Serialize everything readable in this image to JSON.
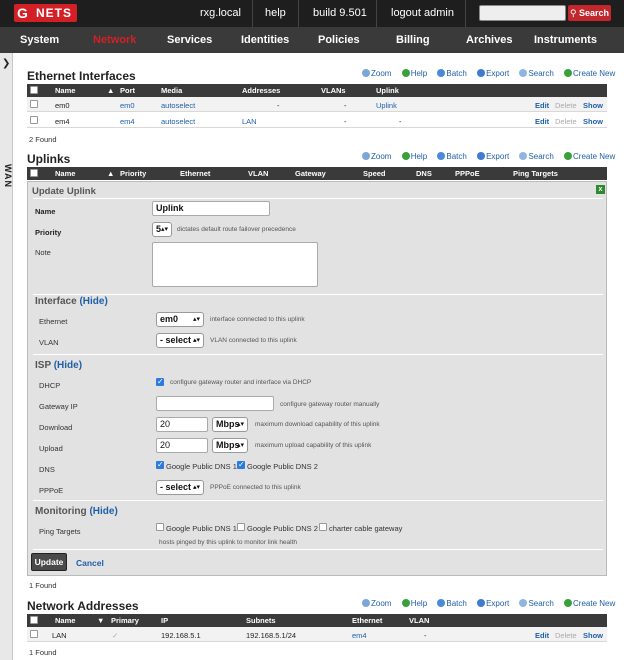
{
  "topbar": {
    "logo_letter": "G",
    "logo_text": "NETS",
    "host": "rxg.local",
    "help": "help",
    "build": "build 9.501",
    "logout": "logout admin",
    "search_placeholder": "",
    "search_button": "Search"
  },
  "nav": [
    "System",
    "Network",
    "Services",
    "Identities",
    "Policies",
    "Billing",
    "Archives",
    "Instruments"
  ],
  "side": {
    "arrow": "❯",
    "label": "WAN"
  },
  "actions": {
    "zoom": "Zoom",
    "help": "Help",
    "batch": "Batch",
    "export": "Export",
    "search": "Search",
    "create": "Create New"
  },
  "ethernet": {
    "title": "Ethernet Interfaces",
    "columns": [
      "Name",
      "Port",
      "Media",
      "Addresses",
      "VLANs",
      "Uplink"
    ],
    "rows": [
      {
        "name": "em0",
        "port": "em0",
        "media": "autoselect",
        "addresses": "-",
        "vlans": "-",
        "uplink": "Uplink"
      },
      {
        "name": "em4",
        "port": "em4",
        "media": "autoselect",
        "addresses": "LAN",
        "vlans": "-",
        "uplink": "-"
      }
    ],
    "found": "2 Found"
  },
  "row_actions": {
    "edit": "Edit",
    "delete": "Delete",
    "show": "Show"
  },
  "uplinks": {
    "title": "Uplinks",
    "columns": [
      "Name",
      "Priority",
      "Ethernet",
      "VLAN",
      "Gateway",
      "Speed",
      "DNS",
      "PPPoE",
      "Ping Targets"
    ],
    "found": "1 Found"
  },
  "form": {
    "title": "Update Uplink",
    "close": "x",
    "name_label": "Name",
    "name_value": "Uplink",
    "priority_label": "Priority",
    "priority_value": "5",
    "priority_hint": "dictates default route failover precedence",
    "note_label": "Note",
    "interface_title": "Interface",
    "hide": "(Hide)",
    "ethernet_label": "Ethernet",
    "ethernet_value": "em0",
    "ethernet_hint": "interface connected to this uplink",
    "vlan_label": "VLAN",
    "vlan_value": "- select -",
    "vlan_hint": "VLAN connected to this uplink",
    "isp_title": "ISP",
    "dhcp_label": "DHCP",
    "dhcp_hint": "configure gateway router and interface via DHCP",
    "gateway_label": "Gateway IP",
    "gateway_hint": "configure gateway router manually",
    "download_label": "Download",
    "download_value": "20",
    "download_unit": "Mbps",
    "download_hint": "maximum download capability of this uplink",
    "upload_label": "Upload",
    "upload_value": "20",
    "upload_unit": "Mbps",
    "upload_hint": "maximum upload capability of this uplink",
    "dns_label": "DNS",
    "dns1": "Google Public DNS 1",
    "dns2": "Google Public DNS 2",
    "pppoe_label": "PPPoE",
    "pppoe_value": "- select -",
    "pppoe_hint": "PPPoE connected to this uplink",
    "monitoring_title": "Monitoring",
    "ping_label": "Ping Targets",
    "ping1": "Google Public DNS 1",
    "ping2": "Google Public DNS 2",
    "ping3": "charter cable gateway",
    "ping_hint": "hosts pinged by this uplink to monitor link health",
    "update_button": "Update",
    "cancel_link": "Cancel"
  },
  "addresses": {
    "title": "Network Addresses",
    "columns": [
      "Name",
      "Primary",
      "IP",
      "Subnets",
      "Ethernet",
      "VLAN"
    ],
    "rows": [
      {
        "name": "LAN",
        "primary": "✓",
        "ip": "192.168.5.1",
        "subnets": "192.168.5.1/24",
        "ethernet": "em4",
        "vlan": "-"
      }
    ],
    "found": "1 Found"
  }
}
